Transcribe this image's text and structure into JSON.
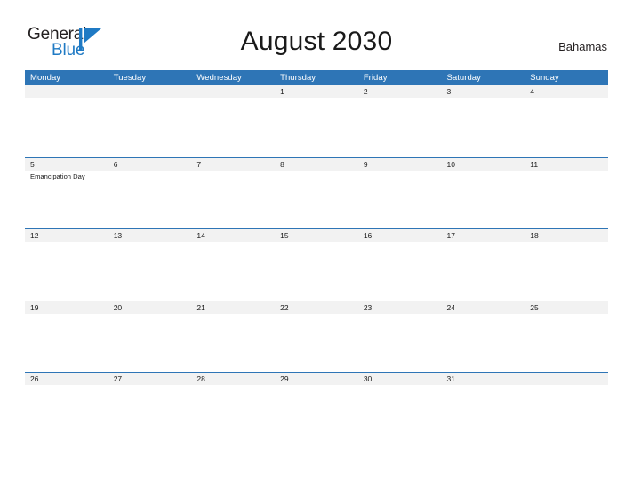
{
  "brand": {
    "name_part1": "General",
    "name_part2": "Blue",
    "flag_icon": "flag-triangle-icon",
    "color_primary": "#1f7ac4",
    "color_text": "#231f20"
  },
  "header": {
    "title": "August 2030",
    "region": "Bahamas"
  },
  "calendar": {
    "colors": {
      "header_blue": "#2e75b6",
      "daynum_strip": "#f2f2f2",
      "row_rule": "#2e75b6",
      "text": "#1a1a1a"
    },
    "weekdays": [
      "Monday",
      "Tuesday",
      "Wednesday",
      "Thursday",
      "Friday",
      "Saturday",
      "Sunday"
    ],
    "weeks": [
      [
        {
          "day": "",
          "events": []
        },
        {
          "day": "",
          "events": []
        },
        {
          "day": "",
          "events": []
        },
        {
          "day": "1",
          "events": []
        },
        {
          "day": "2",
          "events": []
        },
        {
          "day": "3",
          "events": []
        },
        {
          "day": "4",
          "events": []
        }
      ],
      [
        {
          "day": "5",
          "events": [
            "Emancipation Day"
          ]
        },
        {
          "day": "6",
          "events": []
        },
        {
          "day": "7",
          "events": []
        },
        {
          "day": "8",
          "events": []
        },
        {
          "day": "9",
          "events": []
        },
        {
          "day": "10",
          "events": []
        },
        {
          "day": "11",
          "events": []
        }
      ],
      [
        {
          "day": "12",
          "events": []
        },
        {
          "day": "13",
          "events": []
        },
        {
          "day": "14",
          "events": []
        },
        {
          "day": "15",
          "events": []
        },
        {
          "day": "16",
          "events": []
        },
        {
          "day": "17",
          "events": []
        },
        {
          "day": "18",
          "events": []
        }
      ],
      [
        {
          "day": "19",
          "events": []
        },
        {
          "day": "20",
          "events": []
        },
        {
          "day": "21",
          "events": []
        },
        {
          "day": "22",
          "events": []
        },
        {
          "day": "23",
          "events": []
        },
        {
          "day": "24",
          "events": []
        },
        {
          "day": "25",
          "events": []
        }
      ],
      [
        {
          "day": "26",
          "events": []
        },
        {
          "day": "27",
          "events": []
        },
        {
          "day": "28",
          "events": []
        },
        {
          "day": "29",
          "events": []
        },
        {
          "day": "30",
          "events": []
        },
        {
          "day": "31",
          "events": []
        },
        {
          "day": "",
          "events": []
        }
      ]
    ]
  }
}
